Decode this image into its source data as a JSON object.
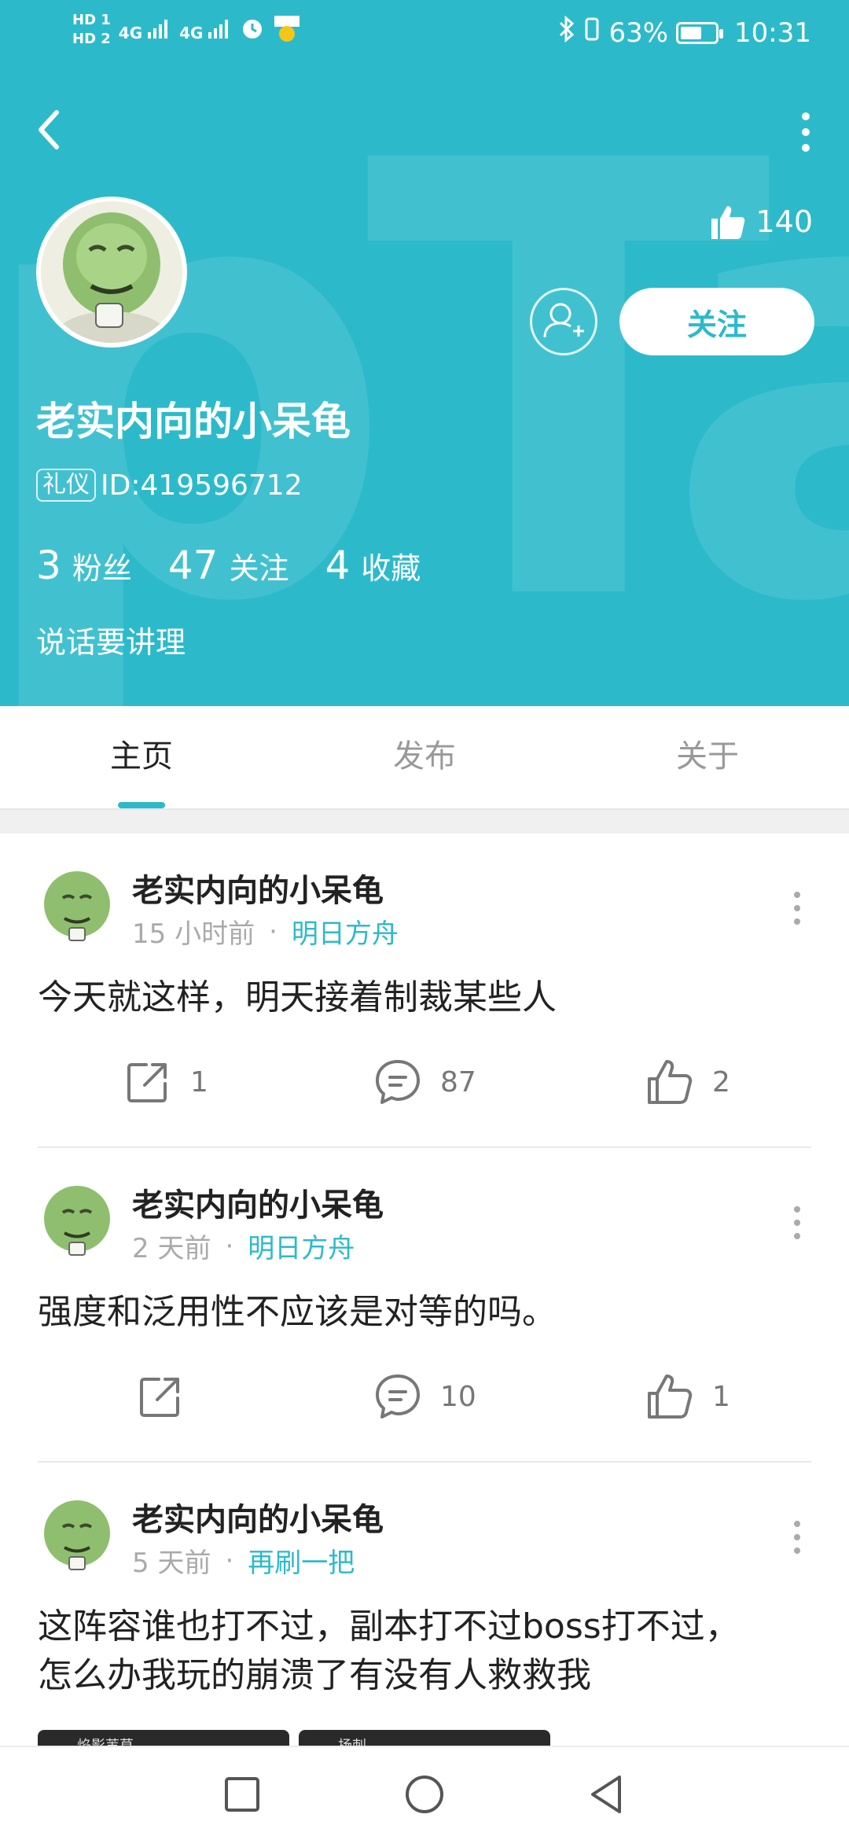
{
  "status_bar": {
    "hd1": "HD 1",
    "hd2": "HD 2",
    "signal1": "4G",
    "signal2": "4G",
    "battery_pct_label": "63%",
    "battery_level": 0.63,
    "time": "10:31",
    "icons": [
      "signal-icon",
      "alarm-icon",
      "notification-icon",
      "bluetooth-icon",
      "vibrate-icon",
      "battery-icon"
    ]
  },
  "profile": {
    "likes": "140",
    "follow_label": "关注",
    "username": "老实内向的小呆龟",
    "tag": "礼仪",
    "user_id": "ID:419596712",
    "stats": [
      {
        "num": "3",
        "label": "粉丝"
      },
      {
        "num": "47",
        "label": "关注"
      },
      {
        "num": "4",
        "label": "收藏"
      }
    ],
    "bio": "说话要讲理"
  },
  "colors": {
    "accent": "#2cbacb",
    "header_bg": "#2cbacb"
  },
  "tabs": [
    {
      "label": "主页",
      "active": true
    },
    {
      "label": "发布",
      "active": false
    },
    {
      "label": "关于",
      "active": false
    }
  ],
  "posts": [
    {
      "author": "老实内向的小呆龟",
      "time": "15 小时前",
      "dot": "·",
      "channel": "明日方舟",
      "text": "今天就这样，明天接着制裁某些人",
      "shares": "1",
      "comments": "87",
      "likes": "2"
    },
    {
      "author": "老实内向的小呆龟",
      "time": "2 天前",
      "dot": "·",
      "channel": "明日方舟",
      "text": "强度和泛用性不应该是对等的吗。",
      "shares": "",
      "comments": "10",
      "likes": "1"
    },
    {
      "author": "老实内向的小呆龟",
      "time": "5 天前",
      "dot": "·",
      "channel": "再刷一把",
      "text_line1": "这阵容谁也打不过，副本打不过boss打不过，",
      "text_line2": "怎么办我玩的崩溃了有没有人救救我",
      "thumb1": "焰影苇草",
      "thumb2": "扬刺"
    }
  ],
  "nav": {
    "icons": [
      "recent-apps-icon",
      "home-icon",
      "back-icon"
    ]
  }
}
